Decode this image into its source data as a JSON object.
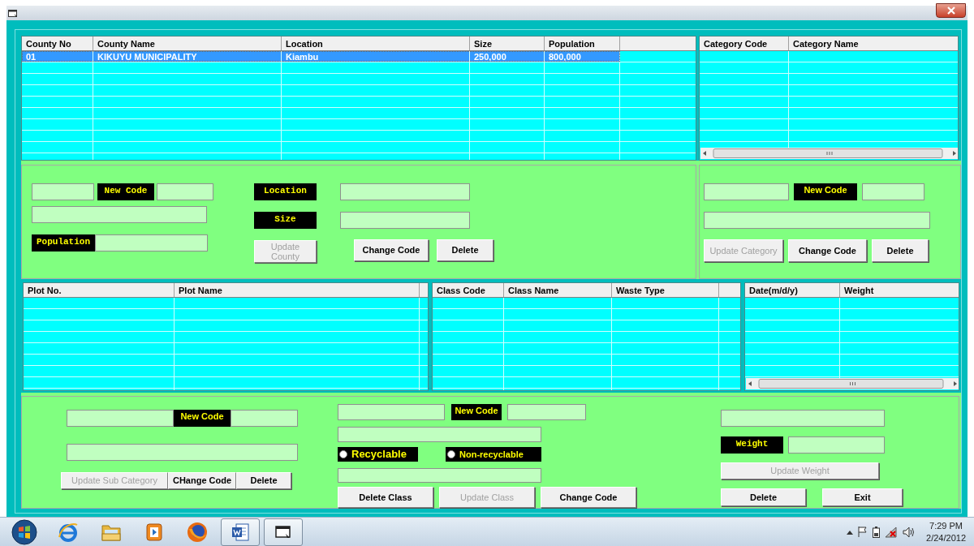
{
  "county_table": {
    "columns": [
      "County No",
      "County Name",
      "Location",
      "Size",
      "Population"
    ],
    "rows": [
      {
        "cells": [
          "01",
          "KIKUYU MUNICIPALITY",
          "Kiambu",
          "250,000",
          "800,000"
        ],
        "selected": true
      }
    ]
  },
  "category_table": {
    "columns": [
      "Category Code",
      "Category Name"
    ]
  },
  "county_form": {
    "labels": [
      "New Code",
      "Location",
      "Size",
      "Population"
    ],
    "buttons": [
      {
        "label": "Update County",
        "disabled": true
      },
      {
        "label": "Change Code",
        "disabled": false
      },
      {
        "label": "Delete",
        "disabled": false
      }
    ]
  },
  "category_form": {
    "labels": [
      "New Code"
    ],
    "buttons": [
      {
        "label": "Update Category",
        "disabled": true
      },
      {
        "label": "Change Code",
        "disabled": false
      },
      {
        "label": "Delete",
        "disabled": false
      }
    ]
  },
  "plot_table": {
    "columns": [
      "Plot No.",
      "Plot Name"
    ]
  },
  "class_table": {
    "columns": [
      "Class Code",
      "Class Name",
      "Waste Type"
    ]
  },
  "weight_table": {
    "columns": [
      "Date(m/d/y)",
      "Weight"
    ]
  },
  "sub_category_form": {
    "labels": [
      "New Code"
    ],
    "buttons": [
      {
        "label": "Update Sub Category",
        "disabled": true
      },
      {
        "label": "CHange Code",
        "disabled": false
      },
      {
        "label": "Delete",
        "disabled": false
      }
    ]
  },
  "class_form": {
    "labels": [
      "New Code"
    ],
    "waste_types": [
      {
        "label": "Recyclable",
        "selected": false
      },
      {
        "label": "Non-recyclable",
        "selected": false
      }
    ],
    "buttons": [
      {
        "label": "Delete Class",
        "disabled": false
      },
      {
        "label": "Update Class",
        "disabled": true
      },
      {
        "label": "Change Code",
        "disabled": false
      }
    ]
  },
  "weight_form": {
    "labels": [
      "Weight"
    ],
    "buttons": [
      {
        "label": "Update Weight",
        "disabled": true
      },
      {
        "label": "Delete",
        "disabled": false
      },
      {
        "label": "Exit",
        "disabled": false
      }
    ]
  },
  "taskbar": {
    "apps": [
      {
        "kind": "browser",
        "running": false
      },
      {
        "kind": "folder",
        "running": false
      },
      {
        "kind": "media",
        "running": false
      },
      {
        "kind": "globe",
        "running": false
      },
      {
        "kind": "document",
        "running": true
      },
      {
        "kind": "window",
        "running": true
      }
    ],
    "clock": {
      "time": "7:29 PM",
      "date": "2/24/2012"
    }
  }
}
